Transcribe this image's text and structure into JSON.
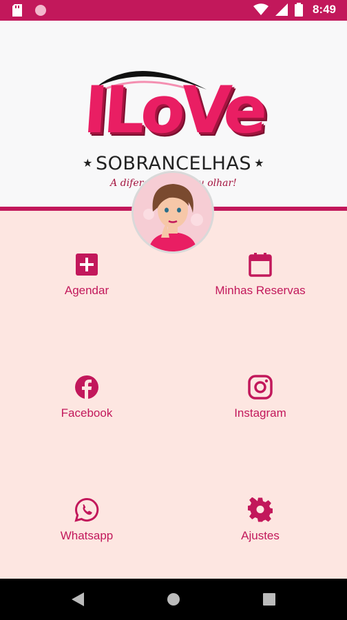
{
  "status_bar": {
    "time": "8:49",
    "icons": [
      "sd-card-icon",
      "circle-icon",
      "wifi-icon",
      "signal-icon",
      "battery-icon"
    ],
    "color": "#c2185b"
  },
  "logo": {
    "title": "ILoVe",
    "subtitle": "SOBRANCELHAS",
    "star": "★",
    "tagline": "A diferença em seu olhar!"
  },
  "menu": {
    "agendar": "Agendar",
    "minhas_reservas": "Minhas Reservas",
    "facebook": "Facebook",
    "instagram": "Instagram",
    "whatsapp": "Whatsapp",
    "ajustes": "Ajustes"
  },
  "nav_bar": {
    "icons": [
      "back-icon",
      "home-icon",
      "recents-icon"
    ]
  },
  "colors": {
    "accent": "#c2185b",
    "background": "#fde6e1",
    "header_bg": "#f8f8f9"
  }
}
